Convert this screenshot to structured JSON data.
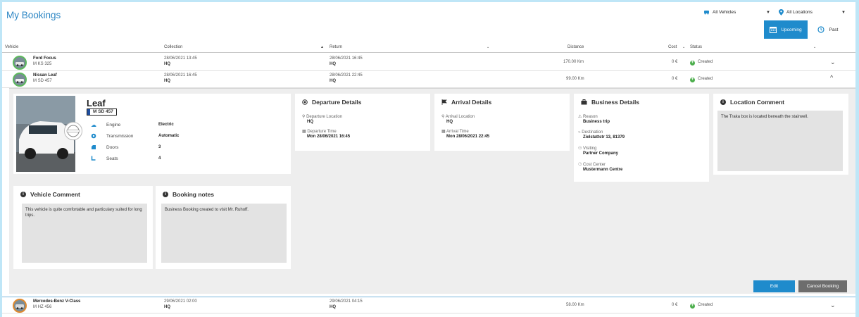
{
  "page": {
    "title": "My Bookings"
  },
  "filters": {
    "vehicles": {
      "label": "All Vehicles",
      "icon": "car-icon"
    },
    "locations": {
      "label": "All Locations",
      "icon": "map-pin-icon"
    }
  },
  "tabs": {
    "upcoming": "Upcoming",
    "past": "Past"
  },
  "table": {
    "headers": {
      "vehicle": "Vehicle",
      "collection": "Collection",
      "return": "Return",
      "distance": "Distance",
      "cost": "Cost",
      "status": "Status"
    },
    "rows": [
      {
        "name": "Ford Focus",
        "plate": "M KS 325",
        "collection_date": "28/06/2021 13:45",
        "collection_loc": "HQ",
        "return_date": "28/06/2021 16:45",
        "return_loc": "HQ",
        "distance": "170.00 Km",
        "cost": "0 €",
        "status": "Created"
      },
      {
        "name": "Nissan Leaf",
        "plate": "M SD 457",
        "collection_date": "28/06/2021 16:45",
        "collection_loc": "HQ",
        "return_date": "28/06/2021 22:45",
        "return_loc": "HQ",
        "distance": "99.00 Km",
        "cost": "0 €",
        "status": "Created"
      },
      {
        "name": "Mercedes-Benz V-Class",
        "plate": "M HZ 456",
        "collection_date": "29/06/2021 02:00",
        "collection_loc": "HQ",
        "return_date": "29/06/2021 04:15",
        "return_loc": "HQ",
        "distance": "58.00 Km",
        "cost": "0 €",
        "status": "Created"
      }
    ]
  },
  "detail": {
    "vehicle": {
      "model": "Leaf",
      "plate": "M SD 457",
      "specs": [
        {
          "label": "Engine",
          "value": "Electric",
          "icon": "engine-icon"
        },
        {
          "label": "Transmission",
          "value": "Automatic",
          "icon": "gear-icon"
        },
        {
          "label": "Doors",
          "value": "3",
          "icon": "door-icon"
        },
        {
          "label": "Seats",
          "value": "4",
          "icon": "seat-icon"
        }
      ]
    },
    "departure": {
      "title": "Departure Details",
      "location_label": "Departure Location",
      "location": "HQ",
      "time_label": "Departure Time",
      "time": "Mon 28/06/2021 16:45"
    },
    "arrival": {
      "title": "Arrival Details",
      "location_label": "Arrival Location",
      "location": "HQ",
      "time_label": "Arrival Time",
      "time": "Mon 28/06/2021 22:45"
    },
    "business": {
      "title": "Business Details",
      "reason_label": "Reason",
      "reason": "Business trip",
      "destination_label": "Destination",
      "destination": "Zielstattstr 13, 81379",
      "visiting_label": "Visiting",
      "visiting": "Partner Company",
      "cost_center_label": "Cost Center",
      "cost_center": "Mustermann Centre"
    },
    "location_comment": {
      "title": "Location Comment",
      "text": "The Traka box is located beneath the stairwell."
    },
    "vehicle_comment": {
      "title": "Vehicle Comment",
      "text": "This vehicle is quite comfortable and particulary suited for long trips."
    },
    "booking_notes": {
      "title": "Booking notes",
      "text": "Business Booking created to visit Mr. Ruhoff."
    },
    "actions": {
      "edit": "Edit",
      "cancel": "Cancel Booking"
    }
  },
  "colors": {
    "accent": "#1f8bcc",
    "title": "#2c86c4",
    "status_green": "#4cae4c",
    "cancel_gray": "#6d6d6d"
  }
}
